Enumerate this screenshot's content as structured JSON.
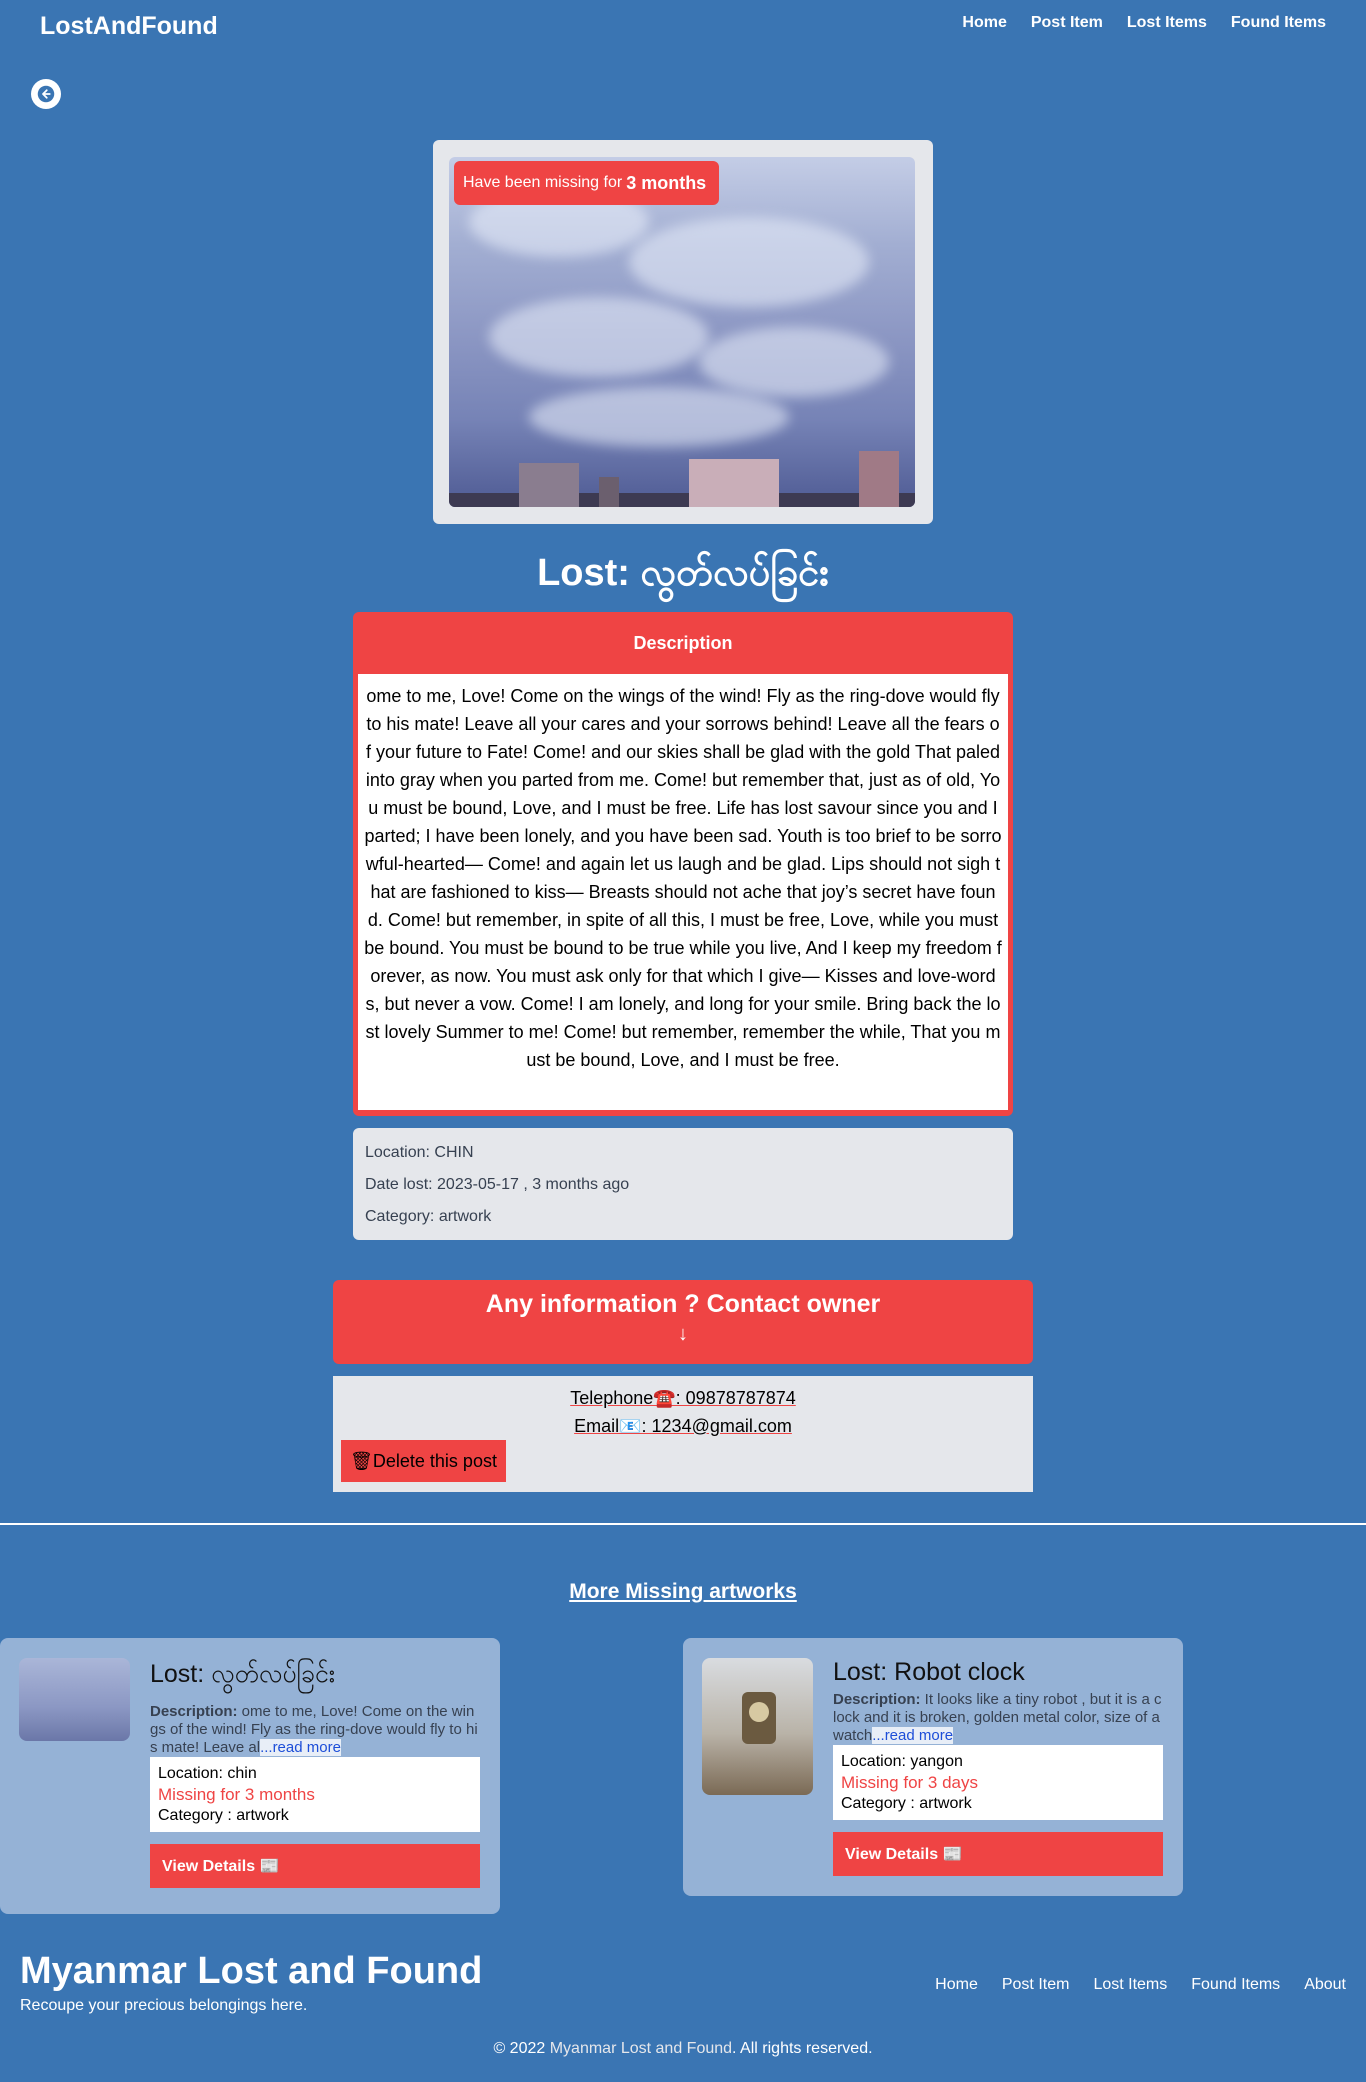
{
  "nav": {
    "brand": "LostAndFound",
    "links": [
      "Home",
      "Post Item",
      "Lost Items",
      "Found Items"
    ]
  },
  "hero": {
    "missing_prefix": "Have been missing for",
    "missing_duration": "3 months"
  },
  "post": {
    "title": "Lost: လွတ်လပ်ခြင်း",
    "description_header": "Description",
    "description": "ome to me, Love! Come on the wings of the wind! Fly as the ring-dove would fly to his mate! Leave all your cares and your sorrows behind! Leave all the fears of your future to Fate! Come! and our skies shall be glad with the gold That paled into gray when you parted from me. Come! but remember that, just as of old, You must be bound, Love, and I must be free. Life has lost savour since you and I parted; I have been lonely, and you have been sad. Youth is too brief to be sorrowful-hearted— Come! and again let us laugh and be glad. Lips should not sigh that are fashioned to kiss— Breasts should not ache that joy’s secret have found. Come! but remember, in spite of all this, I must be free, Love, while you must be bound. You must be bound to be true while you live, And I keep my freedom forever, as now. You must ask only for that which I give— Kisses and love-words, but never a vow. Come! I am lonely, and long for your smile. Bring back the lost lovely Summer to me! Come! but remember, remember the while, That you must be bound, Love, and I must be free.",
    "location": "Location: CHIN",
    "date_lost": "Date lost: 2023-05-17 , 3 months ago",
    "category": "Category: artwork"
  },
  "contact": {
    "title": "Any information ? Contact owner",
    "arrow": "↓",
    "telephone": "Telephone☎️: 09878787874",
    "email": "Email📧: 1234@gmail.com",
    "delete_label": "🗑Delete this post"
  },
  "more": {
    "title": "More Missing artworks",
    "cards": [
      {
        "title": "Lost: လွတ်လပ်ခြင်း",
        "desc_label": "Description:",
        "desc_text": " ome to me, Love! Come on the wings of the wind! Fly as the ring-dove would fly to his mate! Leave al",
        "read_more": "...read more",
        "location": "Location: chin",
        "missing": "Missing for 3 months",
        "category": "Category : artwork",
        "button": "View Details 📰"
      },
      {
        "title": "Lost: Robot clock",
        "desc_label": "Description:",
        "desc_text": " It looks like a tiny robot , but it is a clock and it is broken, golden metal color, size of a watch",
        "read_more": "...read more",
        "location": "Location: yangon",
        "missing": "Missing for 3 days",
        "category": "Category : artwork",
        "button": "View Details 📰"
      }
    ]
  },
  "footer": {
    "title": "Myanmar Lost and Found",
    "tagline": "Recoupe your precious belongings here.",
    "links": [
      "Home",
      "Post Item",
      "Lost Items",
      "Found Items",
      "About"
    ],
    "copyright_prefix": "© 2022 ",
    "copyright_site": "Myanmar Lost and Found",
    "copyright_suffix": ". All rights reserved."
  }
}
